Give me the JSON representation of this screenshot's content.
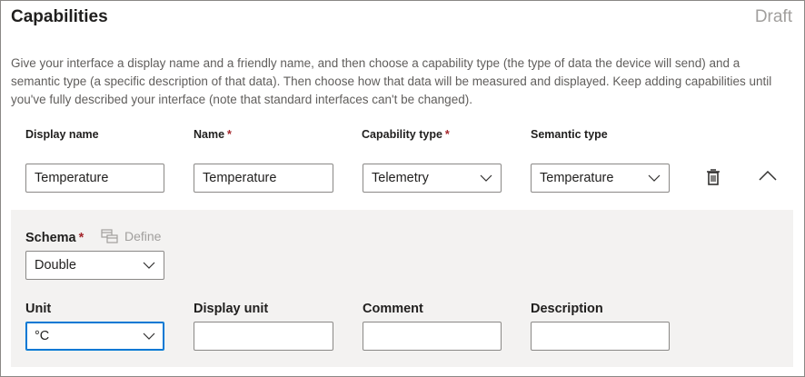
{
  "header": {
    "title": "Capabilities",
    "status": "Draft"
  },
  "description": "Give your interface a display name and a friendly name, and then choose a capability type (the type of data the device will send) and a semantic type (a specific description of that data). Then choose how that data will be measured and displayed. Keep adding capabilities until you've fully described your interface (note that standard interfaces can't be changed).",
  "columns": {
    "display_name": "Display name",
    "name": "Name",
    "capability_type": "Capability type",
    "semantic_type": "Semantic type",
    "required_marker": "*"
  },
  "capability": {
    "display_name": "Temperature",
    "name": "Temperature",
    "capability_type": "Telemetry",
    "semantic_type": "Temperature",
    "delete_icon": "trash-icon",
    "collapse_icon": "chevron-up-icon"
  },
  "details": {
    "schema_label": "Schema",
    "define_label": "Define",
    "schema_value": "Double",
    "unit_label": "Unit",
    "unit_value": "°C",
    "display_unit_label": "Display unit",
    "display_unit_value": "",
    "comment_label": "Comment",
    "comment_value": "",
    "description_label": "Description",
    "description_value": ""
  },
  "colors": {
    "required": "#a4262c",
    "focus": "#0078d4",
    "panel": "#f3f2f1",
    "muted": "#a19f9d"
  }
}
